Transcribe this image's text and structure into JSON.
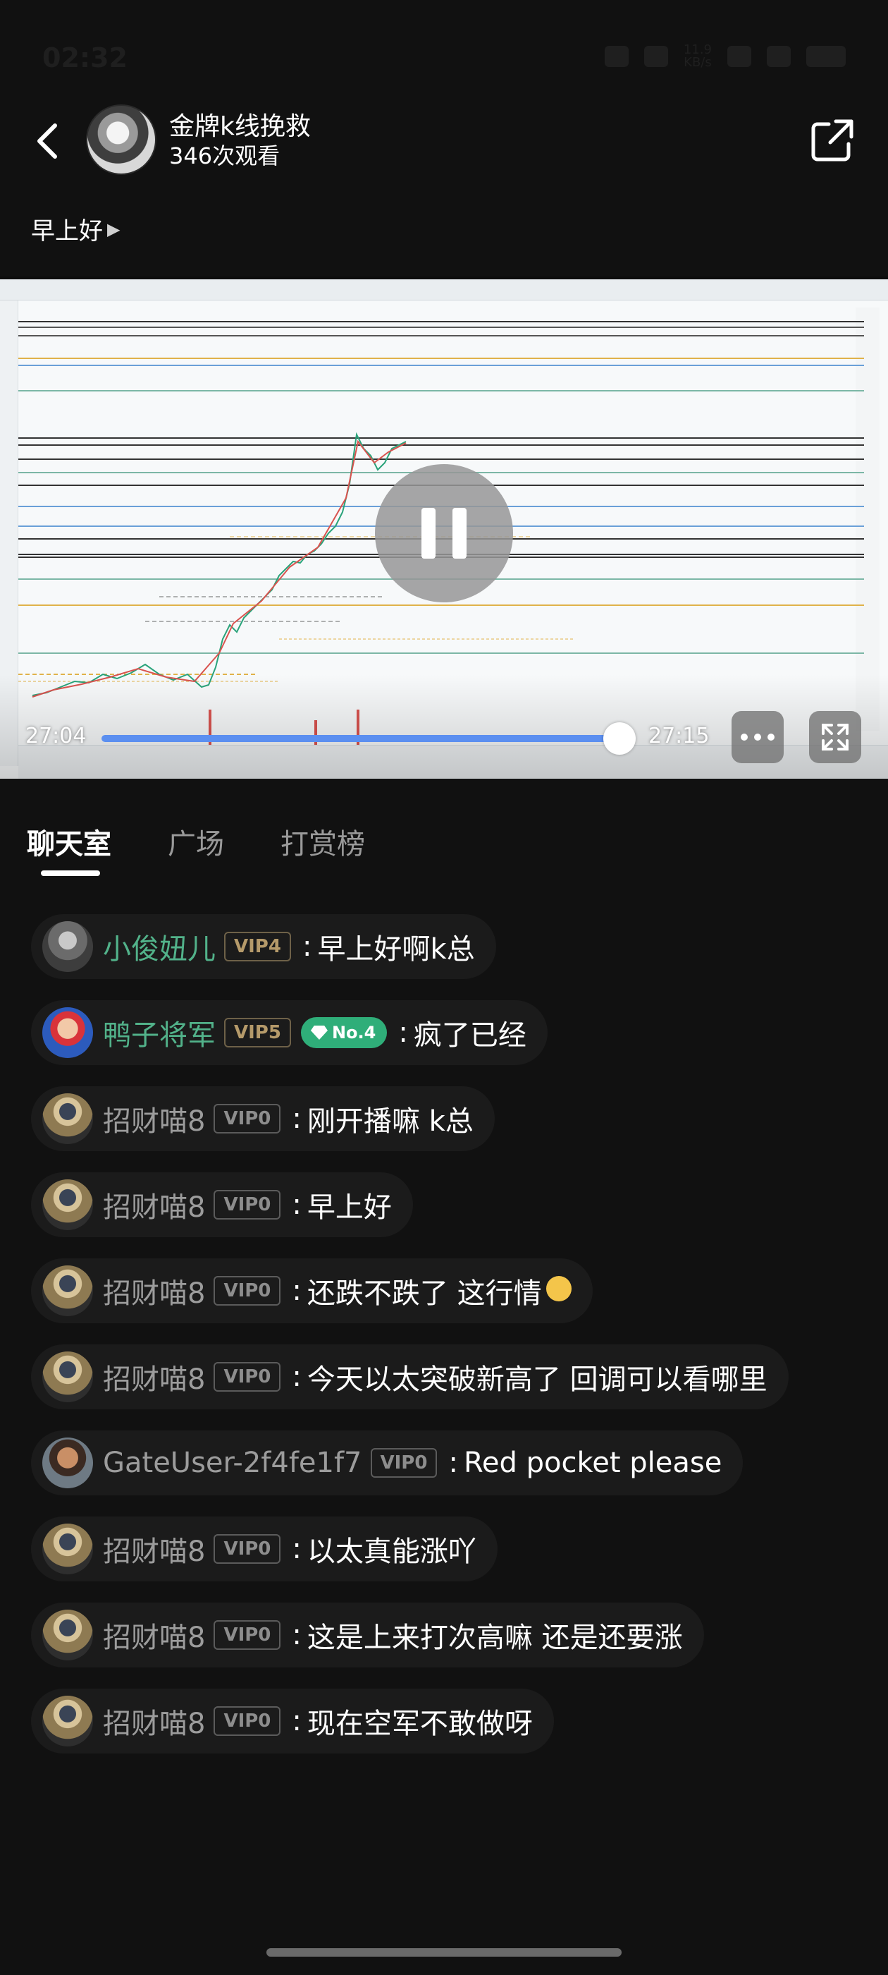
{
  "status_bar": {
    "time": "02:32",
    "net_speed_value": "11.9",
    "net_speed_unit": "KB/s",
    "signal": "5G"
  },
  "header": {
    "host_name": "金牌k线挽救",
    "views": "346次观看"
  },
  "stream_title": "早上好",
  "player": {
    "current_time": "27:04",
    "total_time": "27:15",
    "progress_fraction": 0.985,
    "accent_color": "#5b8ff0"
  },
  "tabs": [
    {
      "label": "聊天室",
      "active": true
    },
    {
      "label": "广场",
      "active": false
    },
    {
      "label": "打赏榜",
      "active": false
    }
  ],
  "messages": [
    {
      "user": "小俊妞儿",
      "vip": "VIP4",
      "text": "早上好啊k总"
    },
    {
      "user": "鸭子将军",
      "vip": "VIP5",
      "rank": "No.4",
      "text": "疯了已经"
    },
    {
      "user": "招财喵8",
      "vip": "VIP0",
      "text": "刚开播嘛 k总"
    },
    {
      "user": "招财喵8",
      "vip": "VIP0",
      "text": "早上好"
    },
    {
      "user": "招财喵8",
      "vip": "VIP0",
      "text": "还跌不跌了 这行情"
    },
    {
      "user": "招财喵8",
      "vip": "VIP0",
      "text": "今天以太突破新高了 回调可以看哪里"
    },
    {
      "user": "GateUser-2f4fe1f7",
      "vip": "VIP0",
      "text": "Red pocket please"
    },
    {
      "user": "招财喵8",
      "vip": "VIP0",
      "text": "以太真能涨吖"
    },
    {
      "user": "招财喵8",
      "vip": "VIP0",
      "text": "这是上来打次高嘛 还是还要涨"
    },
    {
      "user": "招财喵8",
      "vip": "VIP0",
      "text": "现在空军不敢做呀"
    }
  ],
  "colors": {
    "background": "#111111",
    "username_highlight": "#52b28a",
    "rank_badge": "#2fae79"
  }
}
